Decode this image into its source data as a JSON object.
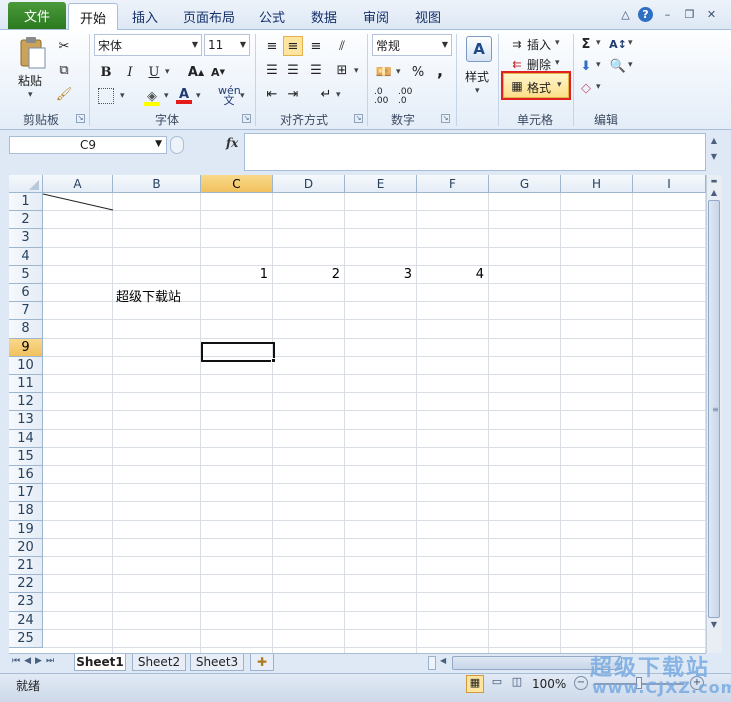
{
  "ribbon_tabs": [
    "文件",
    "开始",
    "插入",
    "页面布局",
    "公式",
    "数据",
    "审阅",
    "视图"
  ],
  "clipboard": {
    "paste": "粘贴",
    "group": "剪贴板"
  },
  "font": {
    "name": "宋体",
    "size": "11",
    "group": "字体",
    "phonetic": "wén 文"
  },
  "alignment": {
    "group": "对齐方式"
  },
  "number": {
    "format": "常规",
    "percent": "%",
    "comma": ",",
    "group": "数字",
    "dec_inc": ".0 .00",
    "dec_dec": ".00 .0"
  },
  "styles": {
    "label": "样式"
  },
  "cells": {
    "insert": "插入",
    "delete": "删除",
    "format": "格式",
    "group": "单元格"
  },
  "editing": {
    "group": "编辑"
  },
  "formula_bar": {
    "name_box": "C9",
    "fx": "fx",
    "value": ""
  },
  "columns": [
    "A",
    "B",
    "C",
    "D",
    "E",
    "F",
    "G",
    "H",
    "I"
  ],
  "rows": [
    "1",
    "2",
    "3",
    "4",
    "5",
    "6",
    "7",
    "8",
    "9",
    "10",
    "11",
    "12",
    "13",
    "14",
    "15",
    "16",
    "17",
    "18",
    "19",
    "20",
    "21",
    "22",
    "23",
    "24",
    "25"
  ],
  "cell_values": {
    "C5": "1",
    "D5": "2",
    "E5": "3",
    "F5": "4",
    "B6": "超级下载站"
  },
  "selected_cell": "C9",
  "sheet_tabs": [
    "Sheet1",
    "Sheet2",
    "Sheet3"
  ],
  "status": {
    "ready": "就绪",
    "zoom": "100%"
  },
  "watermark": {
    "line1": "超级下载站",
    "line2": "www.CJXZ.com"
  },
  "colors": {
    "highlight_box": "#e02020",
    "file_tab": "#2b7a1f",
    "selection": "#f1c15e"
  }
}
